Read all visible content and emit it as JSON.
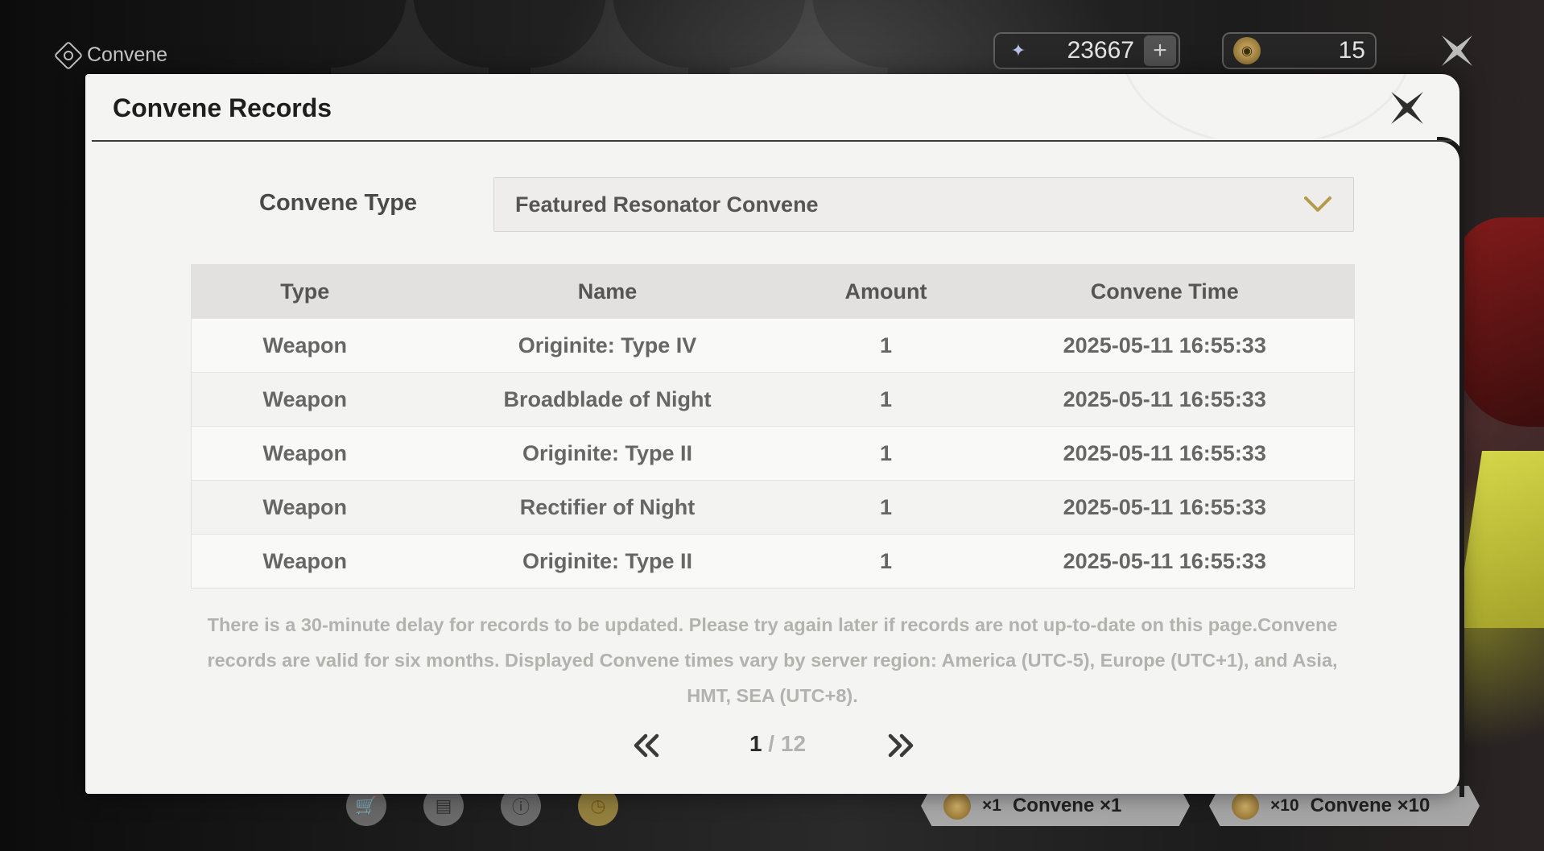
{
  "app": {
    "title": "Convene"
  },
  "currencies": {
    "astrite": {
      "icon": "astrite-star-icon",
      "value": "23667",
      "plus": "+"
    },
    "tide": {
      "icon": "radiant-tide-icon",
      "value": "15"
    }
  },
  "modal": {
    "title": "Convene Records",
    "type_label": "Convene Type",
    "type_selected": "Featured Resonator Convene",
    "table": {
      "columns": [
        "Type",
        "Name",
        "Amount",
        "Convene Time"
      ],
      "rows": [
        [
          "Weapon",
          "Originite: Type IV",
          "1",
          "2025-05-11 16:55:33"
        ],
        [
          "Weapon",
          "Broadblade of Night",
          "1",
          "2025-05-11 16:55:33"
        ],
        [
          "Weapon",
          "Originite: Type II",
          "1",
          "2025-05-11 16:55:33"
        ],
        [
          "Weapon",
          "Rectifier of Night",
          "1",
          "2025-05-11 16:55:33"
        ],
        [
          "Weapon",
          "Originite: Type II",
          "1",
          "2025-05-11 16:55:33"
        ]
      ]
    },
    "notice": "There is a 30-minute delay for records to be updated. Please try again later if records are not up-to-date on this page.Convene records are valid for six months. Displayed Convene times vary by server region: America (UTC-5), Europe (UTC+1), and Asia, HMT, SEA (UTC+8).",
    "pagination": {
      "current": "1",
      "separator": " / ",
      "total": "12"
    }
  },
  "bottom": {
    "convene_one": {
      "mult": "×1",
      "label": "Convene ×1"
    },
    "convene_ten": {
      "mult": "×10",
      "label": "Convene ×10"
    }
  },
  "colors": {
    "accent_gold": "#b69a4c",
    "modal_bg": "#f4f4f2",
    "header_row": "#e2e1df"
  }
}
